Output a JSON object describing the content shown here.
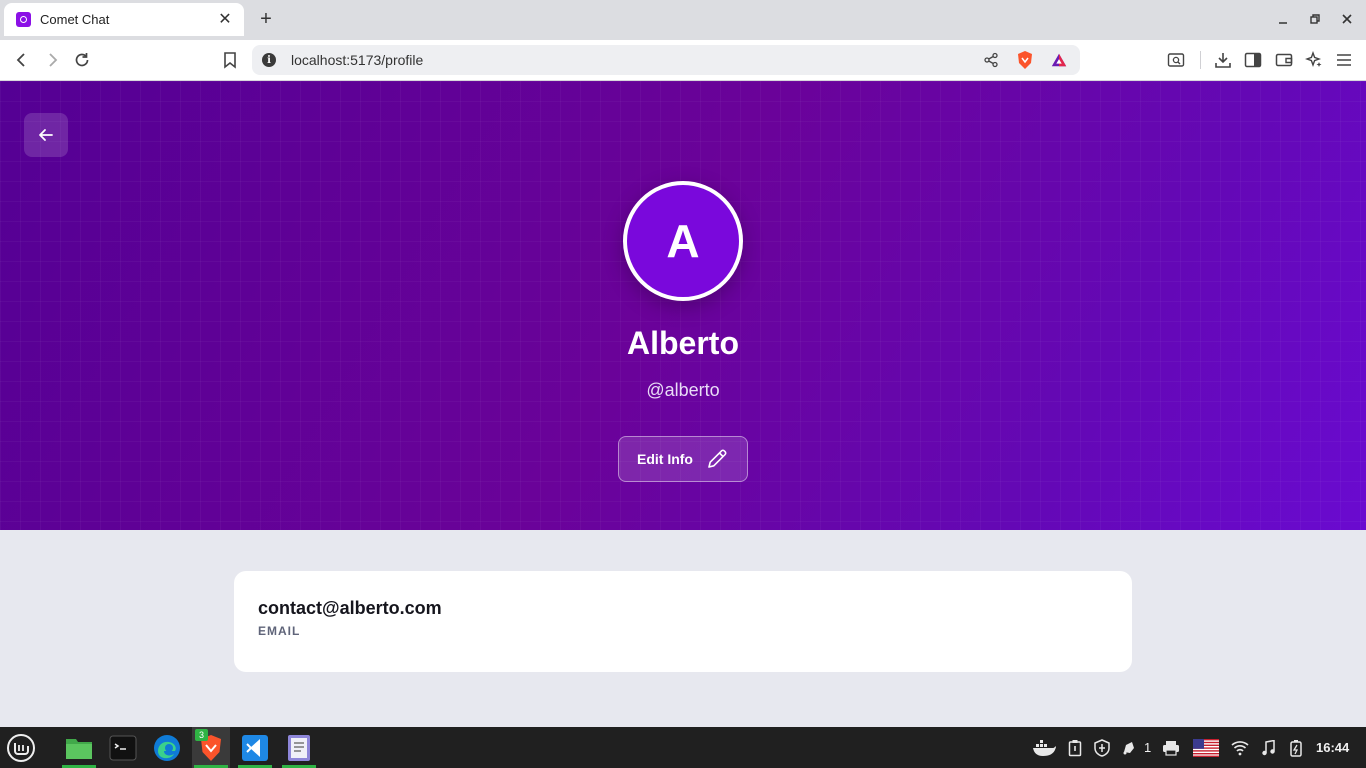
{
  "browser": {
    "tab_title": "Comet Chat",
    "url": "localhost:5173/profile",
    "colors": {
      "favicon": "#8b10e6",
      "brave_lion": "#fb542b"
    }
  },
  "profile": {
    "avatar_initial": "A",
    "display_name": "Alberto",
    "username": "@alberto",
    "edit_button_label": "Edit Info",
    "colors": {
      "hero_start": "#540094",
      "hero_end": "#6a0ad0",
      "avatar_bg": "#7a08dc"
    }
  },
  "info_card": {
    "email_value": "contact@alberto.com",
    "email_label": "EMAIL"
  },
  "taskbar": {
    "apps": [
      "menu-icon",
      "files-icon",
      "terminal-icon",
      "edge-icon",
      "brave-icon",
      "vscode-icon",
      "text-editor-icon"
    ],
    "brave_badge": "3",
    "tray_notification_count": "1",
    "clock": "16:44"
  }
}
